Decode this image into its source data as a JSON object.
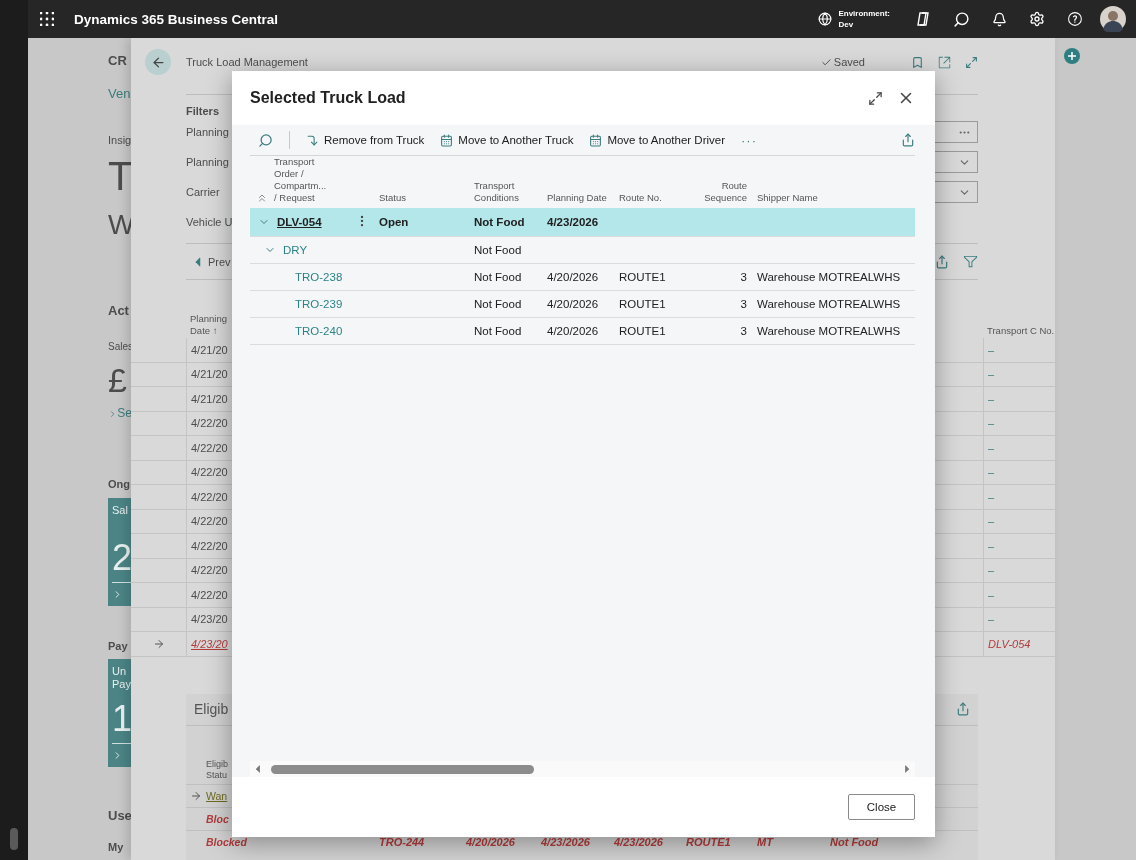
{
  "top_bar": {
    "app_title": "Dynamics 365 Business Central",
    "environment_label": "Environment:",
    "environment_value": "Dev"
  },
  "home_page": {
    "company": "CR",
    "link": "Ven",
    "insights_label": "Insig",
    "headline_1": "T",
    "headline_2": "W",
    "actions_title": "Act",
    "sales_label": "Sales",
    "sales_amount": "£",
    "see_more_link": "Se",
    "ongoing_title": "Ong",
    "ongoing_tile": {
      "label": "Sal",
      "value": "2"
    },
    "payments_title": "Pay",
    "payments_tile": {
      "label": "Un Pay",
      "value": "1"
    },
    "user_title": "Use",
    "user_label": "My"
  },
  "truck_page": {
    "breadcrumb": "Truck Load Management",
    "save_state": "Saved",
    "filters_title": "Filters",
    "filters": [
      {
        "label": "Planning",
        "kind": "lookup"
      },
      {
        "label": "Planning",
        "kind": "dropdown"
      },
      {
        "label": "Carrier",
        "kind": "dropdown"
      },
      {
        "label": "Vehicle U",
        "kind": "text"
      }
    ],
    "previous_label": "Prev",
    "columns": [
      "Planning Date ↑",
      "Transport C No."
    ],
    "rows": [
      {
        "date": "4/21/20",
        "transport_no": "–",
        "selected": false
      },
      {
        "date": "4/21/20",
        "transport_no": "–",
        "selected": false
      },
      {
        "date": "4/21/20",
        "transport_no": "–",
        "selected": false
      },
      {
        "date": "4/22/20",
        "transport_no": "–",
        "selected": false
      },
      {
        "date": "4/22/20",
        "transport_no": "–",
        "selected": false
      },
      {
        "date": "4/22/20",
        "transport_no": "–",
        "selected": false
      },
      {
        "date": "4/22/20",
        "transport_no": "–",
        "selected": false
      },
      {
        "date": "4/22/20",
        "transport_no": "–",
        "selected": false
      },
      {
        "date": "4/22/20",
        "transport_no": "–",
        "selected": false
      },
      {
        "date": "4/22/20",
        "transport_no": "–",
        "selected": false
      },
      {
        "date": "4/22/20",
        "transport_no": "–",
        "selected": false
      },
      {
        "date": "4/23/20",
        "transport_no": "–",
        "selected": false
      },
      {
        "date": "4/23/20",
        "transport_no": "DLV-054",
        "selected": true
      }
    ],
    "eligible": {
      "title": "Eligib",
      "column": "Eligib Statu",
      "rows": [
        {
          "status": "Wan",
          "kind": "warning",
          "selected": true
        },
        {
          "status": "Bloc",
          "kind": "blocked",
          "selected": false
        },
        {
          "status": "Blocked",
          "kind": "blocked",
          "selected": false,
          "cells": [
            "TRO-244",
            "4/20/2026",
            "4/23/2026",
            "4/23/2026",
            "ROUTE1",
            "MT",
            "Not Food"
          ]
        }
      ]
    }
  },
  "dialog": {
    "title": "Selected Truck Load",
    "actions": [
      {
        "kind": "search"
      },
      {
        "kind": "remove",
        "label": "Remove from Truck"
      },
      {
        "kind": "calendar",
        "label": "Move to Another Truck"
      },
      {
        "kind": "calendar",
        "label": "Move to Another Driver"
      },
      {
        "kind": "more",
        "label": "···"
      }
    ],
    "columns": [
      "Transport Order / Compartm... / Request",
      "Status",
      "Transport Conditions",
      "Planning Date",
      "Route No.",
      "Route Sequence",
      "Shipper Name"
    ],
    "rows": [
      {
        "no": "DLV-054",
        "status": "Open",
        "conditions": "Not Food",
        "planning_date": "4/23/2026",
        "selected": true,
        "expanded": true,
        "children": [
          {
            "no": "DRY",
            "conditions": "Not Food",
            "selected": false,
            "expanded": true,
            "children": [
              {
                "no": "TRO-238",
                "conditions": "Not Food",
                "planning_date": "4/20/2026",
                "route_no": "ROUTE1",
                "route_sequence": "3",
                "shipper_name": "Warehouse MOTREALWHS",
                "selected": false
              },
              {
                "no": "TRO-239",
                "conditions": "Not Food",
                "planning_date": "4/20/2026",
                "route_no": "ROUTE1",
                "route_sequence": "3",
                "shipper_name": "Warehouse MOTREALWHS",
                "selected": false
              },
              {
                "no": "TRO-240",
                "conditions": "Not Food",
                "planning_date": "4/20/2026",
                "route_no": "ROUTE1",
                "route_sequence": "3",
                "shipper_name": "Warehouse MOTREALWHS",
                "selected": false
              }
            ]
          }
        ]
      }
    ],
    "close_button": "Close"
  }
}
